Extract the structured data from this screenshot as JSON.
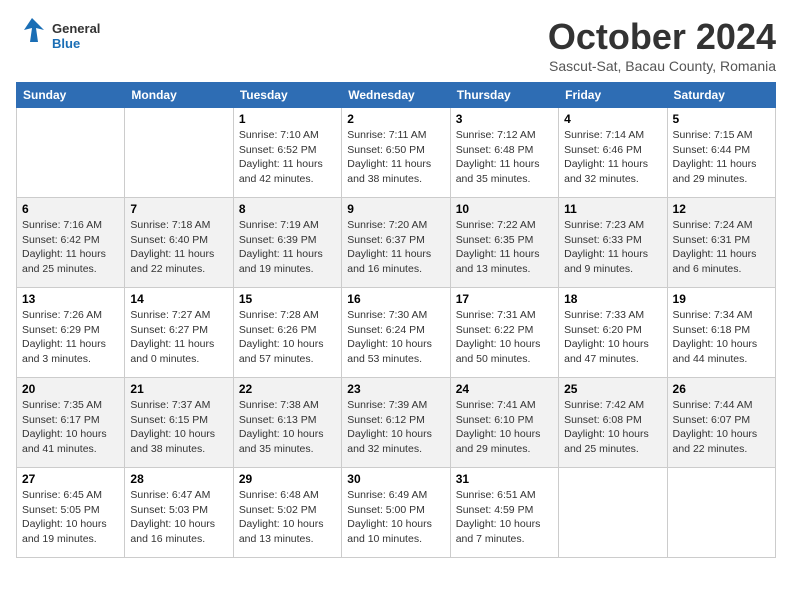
{
  "logo": {
    "line1": "General",
    "line2": "Blue"
  },
  "title": "October 2024",
  "subtitle": "Sascut-Sat, Bacau County, Romania",
  "weekdays": [
    "Sunday",
    "Monday",
    "Tuesday",
    "Wednesday",
    "Thursday",
    "Friday",
    "Saturday"
  ],
  "weeks": [
    [
      {
        "day": "",
        "info": ""
      },
      {
        "day": "",
        "info": ""
      },
      {
        "day": "1",
        "info": "Sunrise: 7:10 AM\nSunset: 6:52 PM\nDaylight: 11 hours and 42 minutes."
      },
      {
        "day": "2",
        "info": "Sunrise: 7:11 AM\nSunset: 6:50 PM\nDaylight: 11 hours and 38 minutes."
      },
      {
        "day": "3",
        "info": "Sunrise: 7:12 AM\nSunset: 6:48 PM\nDaylight: 11 hours and 35 minutes."
      },
      {
        "day": "4",
        "info": "Sunrise: 7:14 AM\nSunset: 6:46 PM\nDaylight: 11 hours and 32 minutes."
      },
      {
        "day": "5",
        "info": "Sunrise: 7:15 AM\nSunset: 6:44 PM\nDaylight: 11 hours and 29 minutes."
      }
    ],
    [
      {
        "day": "6",
        "info": "Sunrise: 7:16 AM\nSunset: 6:42 PM\nDaylight: 11 hours and 25 minutes."
      },
      {
        "day": "7",
        "info": "Sunrise: 7:18 AM\nSunset: 6:40 PM\nDaylight: 11 hours and 22 minutes."
      },
      {
        "day": "8",
        "info": "Sunrise: 7:19 AM\nSunset: 6:39 PM\nDaylight: 11 hours and 19 minutes."
      },
      {
        "day": "9",
        "info": "Sunrise: 7:20 AM\nSunset: 6:37 PM\nDaylight: 11 hours and 16 minutes."
      },
      {
        "day": "10",
        "info": "Sunrise: 7:22 AM\nSunset: 6:35 PM\nDaylight: 11 hours and 13 minutes."
      },
      {
        "day": "11",
        "info": "Sunrise: 7:23 AM\nSunset: 6:33 PM\nDaylight: 11 hours and 9 minutes."
      },
      {
        "day": "12",
        "info": "Sunrise: 7:24 AM\nSunset: 6:31 PM\nDaylight: 11 hours and 6 minutes."
      }
    ],
    [
      {
        "day": "13",
        "info": "Sunrise: 7:26 AM\nSunset: 6:29 PM\nDaylight: 11 hours and 3 minutes."
      },
      {
        "day": "14",
        "info": "Sunrise: 7:27 AM\nSunset: 6:27 PM\nDaylight: 11 hours and 0 minutes."
      },
      {
        "day": "15",
        "info": "Sunrise: 7:28 AM\nSunset: 6:26 PM\nDaylight: 10 hours and 57 minutes."
      },
      {
        "day": "16",
        "info": "Sunrise: 7:30 AM\nSunset: 6:24 PM\nDaylight: 10 hours and 53 minutes."
      },
      {
        "day": "17",
        "info": "Sunrise: 7:31 AM\nSunset: 6:22 PM\nDaylight: 10 hours and 50 minutes."
      },
      {
        "day": "18",
        "info": "Sunrise: 7:33 AM\nSunset: 6:20 PM\nDaylight: 10 hours and 47 minutes."
      },
      {
        "day": "19",
        "info": "Sunrise: 7:34 AM\nSunset: 6:18 PM\nDaylight: 10 hours and 44 minutes."
      }
    ],
    [
      {
        "day": "20",
        "info": "Sunrise: 7:35 AM\nSunset: 6:17 PM\nDaylight: 10 hours and 41 minutes."
      },
      {
        "day": "21",
        "info": "Sunrise: 7:37 AM\nSunset: 6:15 PM\nDaylight: 10 hours and 38 minutes."
      },
      {
        "day": "22",
        "info": "Sunrise: 7:38 AM\nSunset: 6:13 PM\nDaylight: 10 hours and 35 minutes."
      },
      {
        "day": "23",
        "info": "Sunrise: 7:39 AM\nSunset: 6:12 PM\nDaylight: 10 hours and 32 minutes."
      },
      {
        "day": "24",
        "info": "Sunrise: 7:41 AM\nSunset: 6:10 PM\nDaylight: 10 hours and 29 minutes."
      },
      {
        "day": "25",
        "info": "Sunrise: 7:42 AM\nSunset: 6:08 PM\nDaylight: 10 hours and 25 minutes."
      },
      {
        "day": "26",
        "info": "Sunrise: 7:44 AM\nSunset: 6:07 PM\nDaylight: 10 hours and 22 minutes."
      }
    ],
    [
      {
        "day": "27",
        "info": "Sunrise: 6:45 AM\nSunset: 5:05 PM\nDaylight: 10 hours and 19 minutes."
      },
      {
        "day": "28",
        "info": "Sunrise: 6:47 AM\nSunset: 5:03 PM\nDaylight: 10 hours and 16 minutes."
      },
      {
        "day": "29",
        "info": "Sunrise: 6:48 AM\nSunset: 5:02 PM\nDaylight: 10 hours and 13 minutes."
      },
      {
        "day": "30",
        "info": "Sunrise: 6:49 AM\nSunset: 5:00 PM\nDaylight: 10 hours and 10 minutes."
      },
      {
        "day": "31",
        "info": "Sunrise: 6:51 AM\nSunset: 4:59 PM\nDaylight: 10 hours and 7 minutes."
      },
      {
        "day": "",
        "info": ""
      },
      {
        "day": "",
        "info": ""
      }
    ]
  ]
}
